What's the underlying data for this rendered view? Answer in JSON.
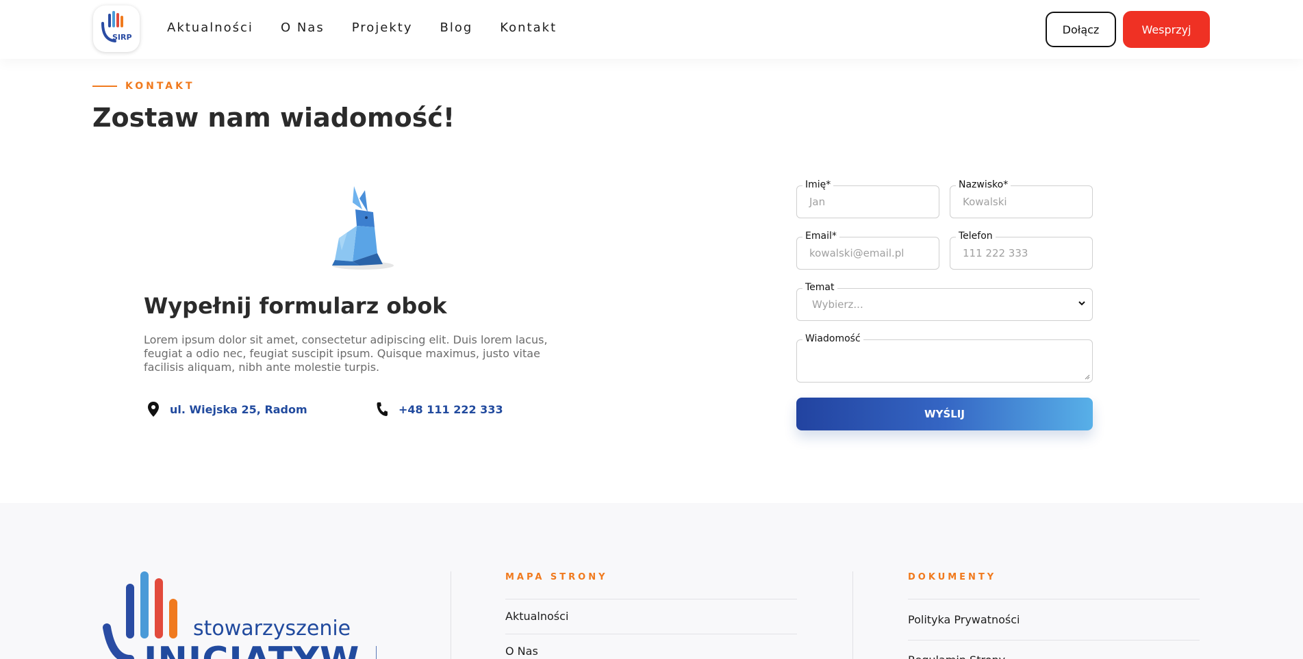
{
  "header": {
    "logo_text": "SIRP",
    "nav": [
      "Aktualności",
      "O Nas",
      "Projekty",
      "Blog",
      "Kontakt"
    ],
    "join_label": "Dołącz",
    "support_label": "Wesprzyj"
  },
  "section": {
    "eyebrow": "KONTAKT",
    "title": "Zostaw nam wiadomość!",
    "heading": "Wypełnij formularz obok",
    "body": "Lorem ipsum dolor sit amet, consectetur adipiscing elit. Duis lorem lacus, feugiat a odio nec, feugiat suscipit ipsum. Quisque maximus, justo vitae facilisis aliquam, nibh ante molestie turpis.",
    "address": "ul. Wiejska 25, Radom",
    "phone": "+48 111 222 333"
  },
  "form": {
    "first_name": {
      "label": "Imię*",
      "placeholder": "Jan"
    },
    "last_name": {
      "label": "Nazwisko*",
      "placeholder": "Kowalski"
    },
    "email": {
      "label": "Email*",
      "placeholder": "kowalski@email.pl"
    },
    "phone": {
      "label": "Telefon",
      "placeholder": "111 222 333"
    },
    "subject": {
      "label": "Temat",
      "selected": "Wybierz..."
    },
    "message": {
      "label": "Wiadomość",
      "placeholder": ""
    },
    "submit_label": "WYŚLIJ"
  },
  "footer": {
    "brand_line1": "stowarzyszenie",
    "brand_line2": "INICJATYW RP",
    "sitemap_title": "MAPA STRONY",
    "sitemap_links": [
      "Aktualności",
      "O Nas"
    ],
    "docs_title": "DOKUMENTY",
    "docs_links": [
      "Polityka Prywatności",
      "Regulamin Strony"
    ]
  },
  "colors": {
    "accent_orange": "#f07a1e",
    "brand_blue": "#214a9e",
    "support_red": "#ef3124"
  },
  "icons": [
    "sirp-logo-icon",
    "map-pin-icon",
    "phone-icon",
    "chevron-down-icon",
    "resize-grip-icon",
    "rabbit-illustration"
  ]
}
